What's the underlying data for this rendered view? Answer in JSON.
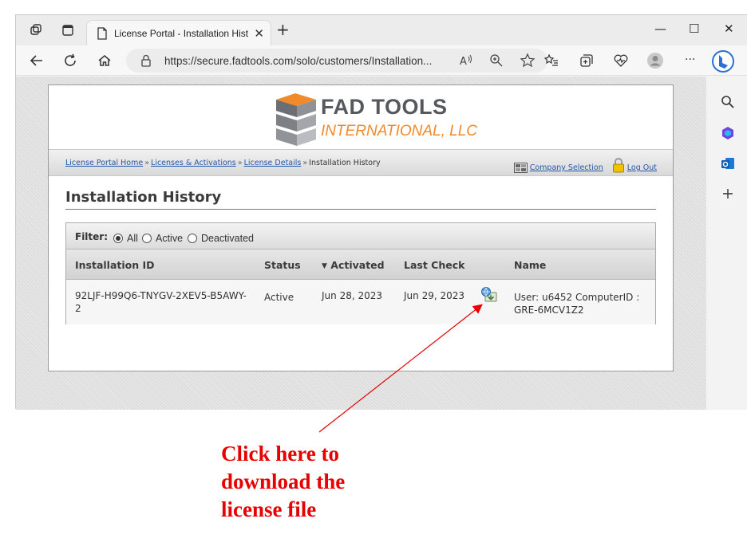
{
  "browser": {
    "tab_title": "License Portal - Installation Histo",
    "tab_close": "✕",
    "new_tab": "+",
    "url": "https://secure.fadtools.com/solo/customers/Installation...",
    "window_min": "—",
    "window_max": "☐",
    "window_close": "✕",
    "more": "···"
  },
  "site": {
    "logo_title": "FAD TOOLS",
    "logo_subtitle": "INTERNATIONAL, LLC",
    "breadcrumbs": [
      {
        "label": "License Portal Home"
      },
      {
        "label": "Licenses & Activations"
      },
      {
        "label": "License Details"
      },
      {
        "label": "Installation History"
      }
    ],
    "crumb_sep": "»",
    "company_selection": "Company Selection",
    "log_out": "Log Out",
    "page_title": "Installation History"
  },
  "filter": {
    "label": "Filter:",
    "options": [
      "All",
      "Active",
      "Deactivated"
    ],
    "selected": "All"
  },
  "table": {
    "columns": [
      "Installation ID",
      "Status",
      "Activated",
      "Last Check",
      "Name"
    ],
    "sort_arrow": "▼",
    "rows": [
      {
        "installation_id_line1": "92LJF-H99Q6-TNYGV-2XEV5-B5AWY-",
        "installation_id_line2": "2",
        "status": "Active",
        "activated": "Jun 28, 2023",
        "last_check": "Jun 29, 2023",
        "name_line1": "User: u6452 ComputerID :",
        "name_line2": "GRE-6MCV1Z2"
      }
    ]
  },
  "annotation": {
    "lines": [
      "Click here to",
      "download the",
      "license file"
    ],
    "color": "#e60000"
  }
}
